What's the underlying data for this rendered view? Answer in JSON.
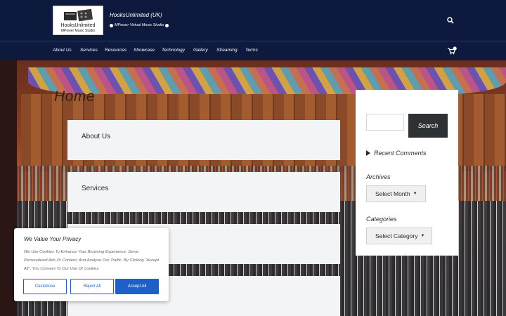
{
  "header": {
    "logo": {
      "main": "HooksUnlimited",
      "sub": "MPower Music Studio"
    },
    "site_title": "HooksUnlimited (UK)",
    "tagline": "MPower Virtual Music Studio"
  },
  "nav": {
    "items": [
      "About Us",
      "Services",
      "Resources",
      "Showcase",
      "Technology",
      "Gallery",
      "Streaming",
      "Terms"
    ],
    "cart_count": ""
  },
  "main": {
    "page_title": "Home",
    "cards": [
      "About Us",
      "Services",
      ""
    ]
  },
  "sidebar": {
    "search_placeholder": "",
    "search_button": "Search",
    "recent_comments": "Recent Comments",
    "archives_title": "Archives",
    "archives_select": "Select Month",
    "categories_title": "Categories",
    "categories_select": "Select Category"
  },
  "cookie": {
    "title": "We Value Your Privacy",
    "text": "We Use Cookies To Enhance Your Browsing Experience, Serve Personalised Ads Or Content, And Analyse Our Traffic. By Clicking \"Accept All\", You Consent To Our Use Of Cookies.",
    "customise": "Customise",
    "reject": "Reject All",
    "accept": "Accept All"
  },
  "colors": {
    "header_bg": "#0d1a3d",
    "accent": "#1f5fc8",
    "search_button_bg": "#2f3234"
  },
  "icons": {
    "search": "search-icon",
    "cart": "cart-icon",
    "recent_toggle": "triangle-right-icon"
  }
}
